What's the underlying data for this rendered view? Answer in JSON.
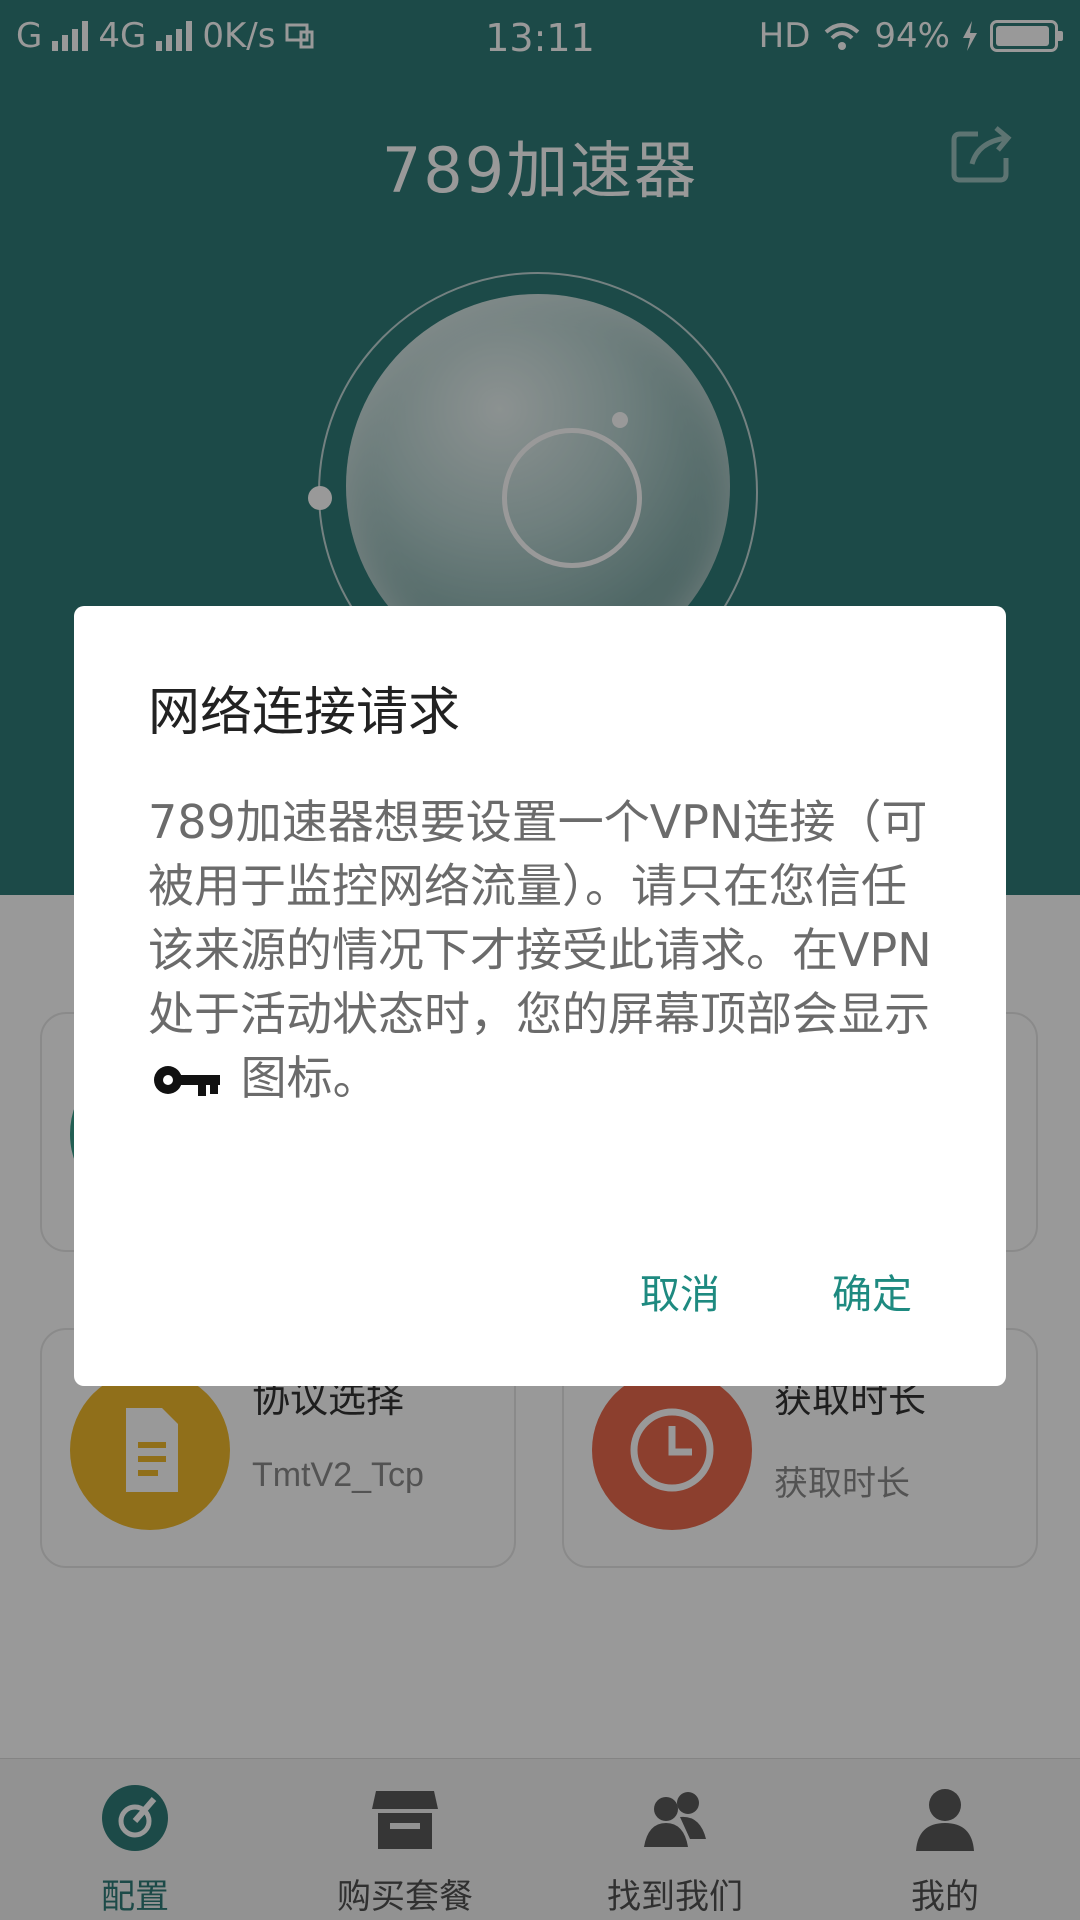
{
  "status_bar": {
    "carrier_left": "G",
    "network": "4G",
    "speed": "0K/s",
    "time": "13:11",
    "hd": "HD",
    "battery": "94%"
  },
  "app": {
    "title": "789加速器",
    "cards": [
      {
        "title": "协议选择",
        "subtitle": "TmtV2_Tcp",
        "icon": "document-icon",
        "color": "#f0b92c"
      },
      {
        "title": "获取时长",
        "subtitle": "获取时长",
        "icon": "clock-icon",
        "color": "#e96a4d"
      }
    ],
    "tabs": [
      {
        "label": "配置",
        "icon": "gauge-icon",
        "active": true
      },
      {
        "label": "购买套餐",
        "icon": "store-icon",
        "active": false
      },
      {
        "label": "找到我们",
        "icon": "people-icon",
        "active": false
      },
      {
        "label": "我的",
        "icon": "person-icon",
        "active": false
      }
    ],
    "theme_color": "#2f7c78"
  },
  "dialog": {
    "title": "网络连接请求",
    "body_main": "789加速器想要设置一个VPN连接（可被用于监控网络流量）。请只在您信任该来源的情况下才接受此请求。在VPN处于活动状态时，您的屏幕顶部会显示",
    "body_tail": "图标。",
    "cancel_label": "取消",
    "confirm_label": "确定",
    "accent_color": "#1e8a80"
  }
}
